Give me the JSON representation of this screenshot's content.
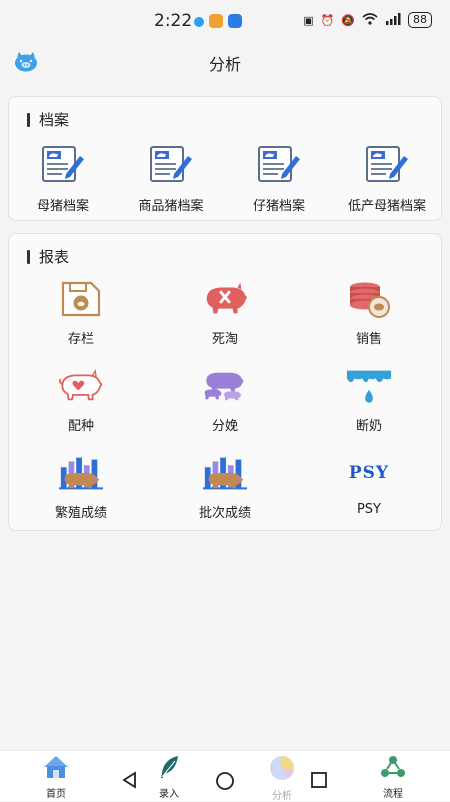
{
  "status_bar": {
    "time": "2:22",
    "battery": "88"
  },
  "app_bar": {
    "title": "分析"
  },
  "archive": {
    "title": "档案",
    "items": [
      {
        "label": "母猪档案",
        "icon": "sow-file-icon"
      },
      {
        "label": "商品猪档案",
        "icon": "commercial-pig-file-icon"
      },
      {
        "label": "仔猪档案",
        "icon": "piglet-file-icon"
      },
      {
        "label": "低产母猪档案",
        "icon": "low-yield-sow-file-icon"
      }
    ]
  },
  "report": {
    "title": "报表",
    "items": [
      {
        "label": "存栏",
        "icon": "inventory-icon"
      },
      {
        "label": "死淘",
        "icon": "death-cull-icon"
      },
      {
        "label": "销售",
        "icon": "sales-icon"
      },
      {
        "label": "配种",
        "icon": "breeding-icon"
      },
      {
        "label": "分娩",
        "icon": "farrowing-icon"
      },
      {
        "label": "断奶",
        "icon": "weaning-icon"
      },
      {
        "label": "繁殖成绩",
        "icon": "reproduction-performance-icon"
      },
      {
        "label": "批次成绩",
        "icon": "batch-performance-icon"
      },
      {
        "label": "PSY",
        "icon": "psy-icon"
      }
    ],
    "psy_icon_text": "PSY"
  },
  "bottom_nav": {
    "items": [
      {
        "label": "首页",
        "icon": "home-icon"
      },
      {
        "label": "录入",
        "icon": "feather-icon"
      },
      {
        "label": "分析",
        "icon": "pie-chart-icon"
      },
      {
        "label": "流程",
        "icon": "process-icon"
      }
    ]
  },
  "colors": {
    "pig_red": "#e06060",
    "pig_pink": "#f08a8a",
    "purple": "#9b7fd6",
    "blue": "#2f6fd6",
    "brown": "#c08a55",
    "teal": "#34a0d8"
  }
}
